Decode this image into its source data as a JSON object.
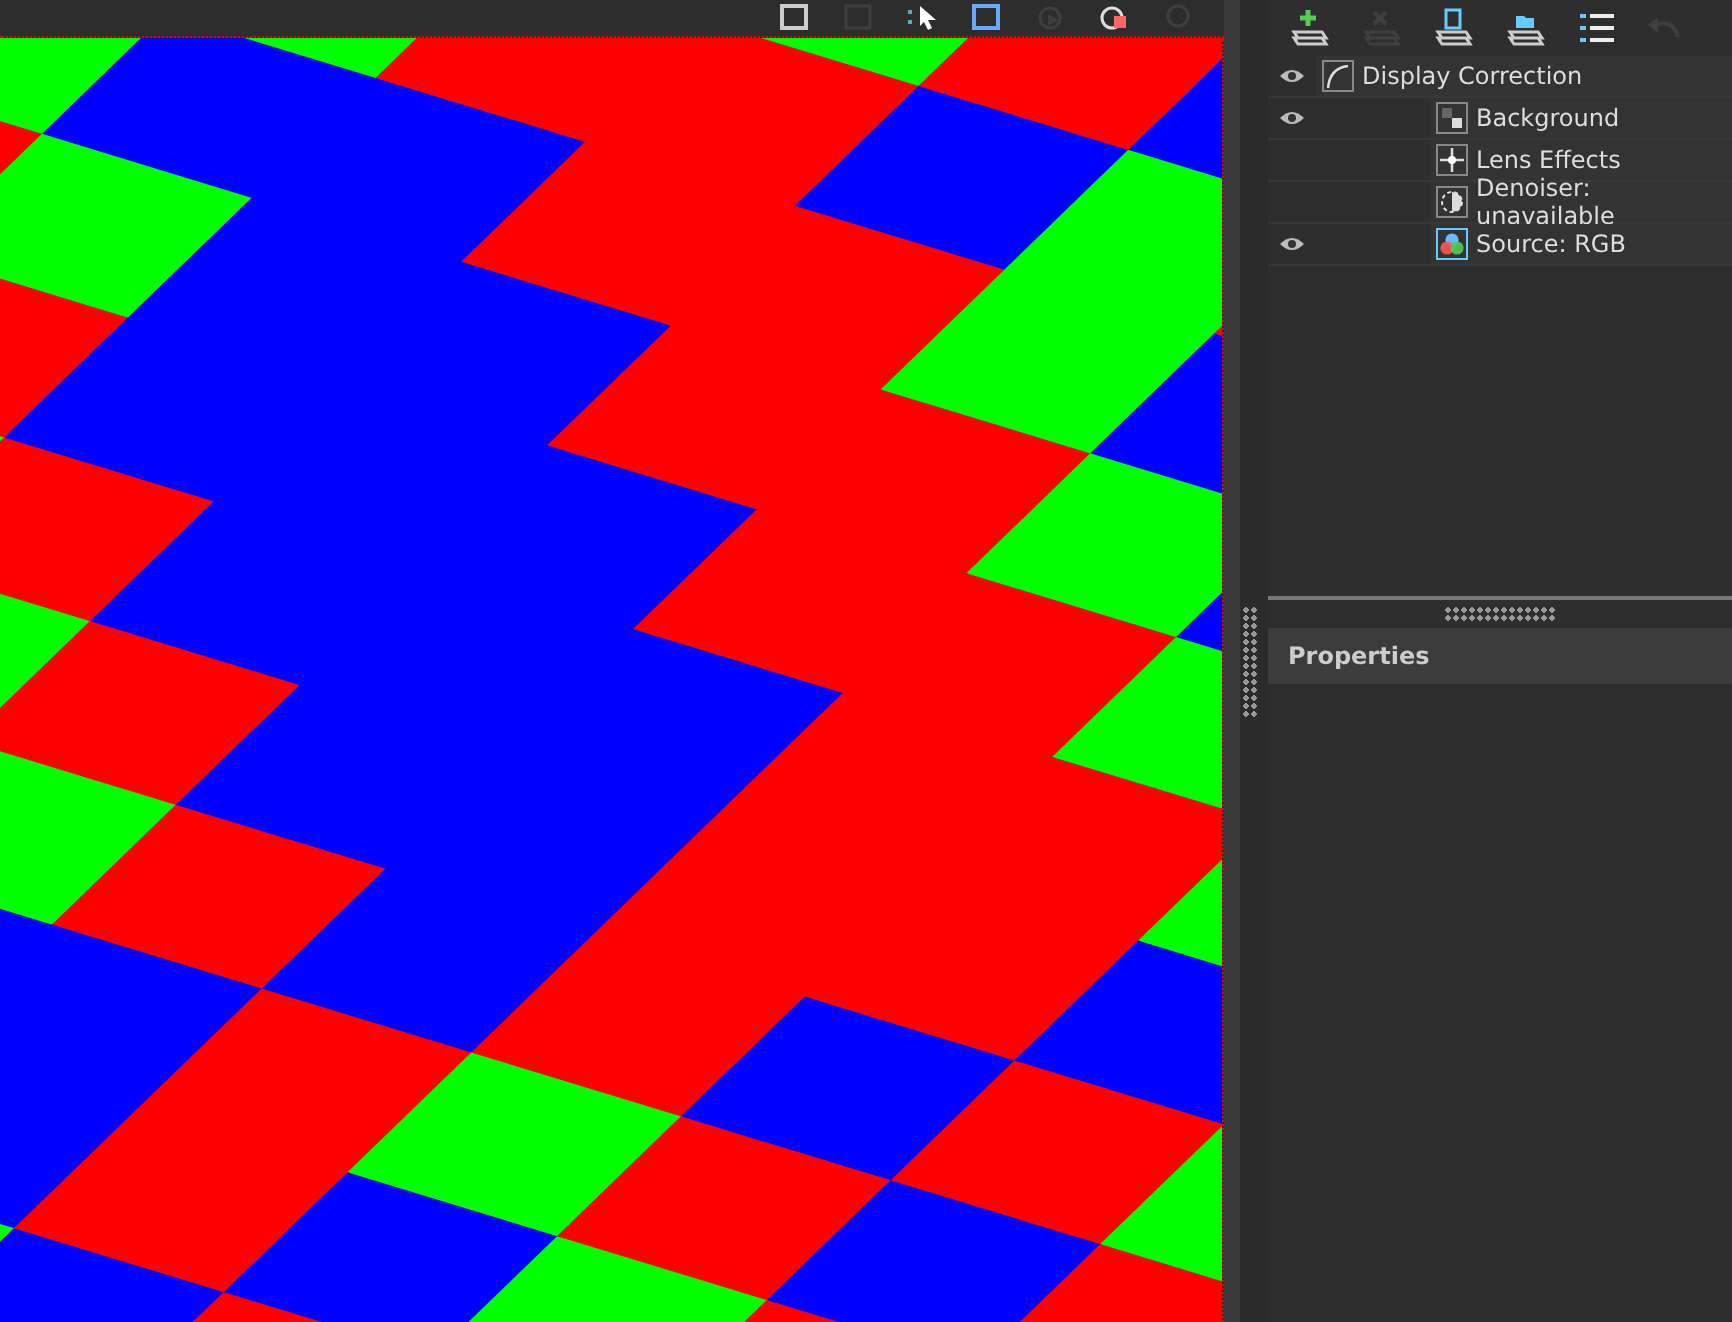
{
  "viewport_toolbar": [
    {
      "kind": "save",
      "disabled": false
    },
    {
      "kind": "crop",
      "disabled": true
    },
    {
      "kind": "pick",
      "disabled": false
    },
    {
      "kind": "region",
      "disabled": false
    },
    {
      "kind": "play",
      "disabled": true
    },
    {
      "kind": "stop",
      "disabled": false
    },
    {
      "kind": "camera",
      "disabled": true
    }
  ],
  "layers_toolbar": [
    {
      "kind": "add",
      "disabled": false
    },
    {
      "kind": "remove",
      "disabled": true
    },
    {
      "kind": "save",
      "disabled": false
    },
    {
      "kind": "open",
      "disabled": false
    },
    {
      "kind": "list",
      "disabled": false
    },
    {
      "kind": "undo",
      "disabled": true
    }
  ],
  "layers": [
    {
      "label": "Display Correction",
      "kind": "curve",
      "visible": true,
      "children": [
        {
          "label": "Background",
          "kind": "background",
          "visible": true
        },
        {
          "label": "Lens Effects",
          "kind": "lens",
          "visible": false
        },
        {
          "label": "Denoiser: unavailable",
          "kind": "denoiser",
          "visible": false
        },
        {
          "label": "Source: RGB",
          "kind": "source",
          "visible": true
        }
      ]
    }
  ],
  "properties": {
    "title": "Properties"
  }
}
